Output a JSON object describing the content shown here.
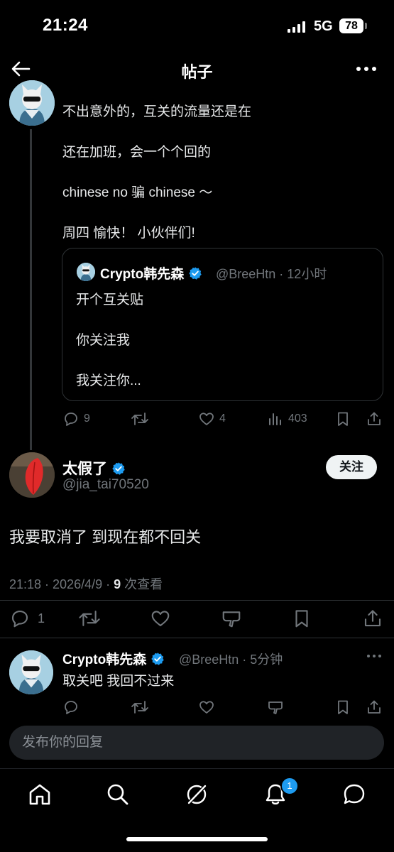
{
  "status_bar": {
    "time": "21:24",
    "network": "5G",
    "battery": "78"
  },
  "header": {
    "title": "帖子"
  },
  "thread_post": {
    "lines": [
      "不出意外的，互关的流量还是在",
      "还在加班，会一个个回的",
      "chinese no 骗 chinese ～",
      "周四 愉快！ 小伙伴们!"
    ],
    "quote": {
      "author": "Crypto韩先森",
      "handle_time": "@BreeHtn · 12小时",
      "lines": [
        "开个互关贴",
        "你关注我",
        "我关注你..."
      ]
    },
    "stats": {
      "replies": "9",
      "likes": "4",
      "views": "403"
    }
  },
  "main_post": {
    "author": "太假了",
    "handle": "@jia_tai70520",
    "follow_label": "关注",
    "text": "我要取消了 到现在都不回关",
    "meta_prefix": "21:18 · 2026/4/9 · ",
    "meta_views": "9",
    "meta_suffix": " 次查看",
    "stats": {
      "replies": "1"
    }
  },
  "reply": {
    "author": "Crypto韩先森",
    "handle_time": "@BreeHtn · 5分钟",
    "text": "取关吧 我回不过来"
  },
  "composer": {
    "placeholder": "发布你的回复"
  },
  "nav": {
    "notification_count": "1"
  },
  "colors": {
    "accent": "#1d9bf0",
    "muted": "#71767b",
    "background": "#000000"
  }
}
